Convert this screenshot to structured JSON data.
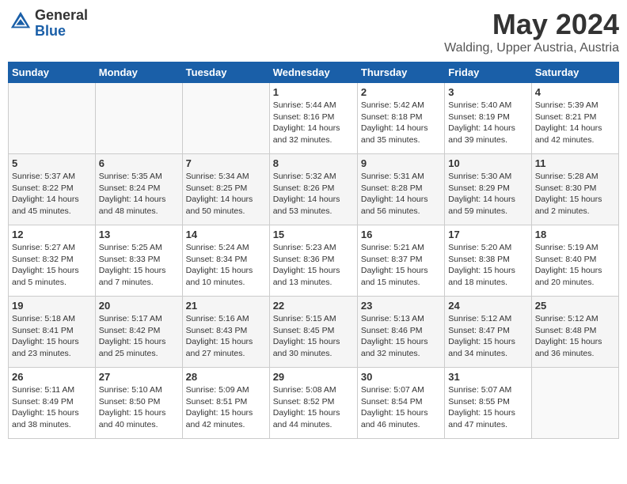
{
  "header": {
    "logo_line1": "General",
    "logo_line2": "Blue",
    "month_title": "May 2024",
    "location": "Walding, Upper Austria, Austria"
  },
  "days_of_week": [
    "Sunday",
    "Monday",
    "Tuesday",
    "Wednesday",
    "Thursday",
    "Friday",
    "Saturday"
  ],
  "weeks": [
    [
      {
        "day": "",
        "info": ""
      },
      {
        "day": "",
        "info": ""
      },
      {
        "day": "",
        "info": ""
      },
      {
        "day": "1",
        "info": "Sunrise: 5:44 AM\nSunset: 8:16 PM\nDaylight: 14 hours\nand 32 minutes."
      },
      {
        "day": "2",
        "info": "Sunrise: 5:42 AM\nSunset: 8:18 PM\nDaylight: 14 hours\nand 35 minutes."
      },
      {
        "day": "3",
        "info": "Sunrise: 5:40 AM\nSunset: 8:19 PM\nDaylight: 14 hours\nand 39 minutes."
      },
      {
        "day": "4",
        "info": "Sunrise: 5:39 AM\nSunset: 8:21 PM\nDaylight: 14 hours\nand 42 minutes."
      }
    ],
    [
      {
        "day": "5",
        "info": "Sunrise: 5:37 AM\nSunset: 8:22 PM\nDaylight: 14 hours\nand 45 minutes."
      },
      {
        "day": "6",
        "info": "Sunrise: 5:35 AM\nSunset: 8:24 PM\nDaylight: 14 hours\nand 48 minutes."
      },
      {
        "day": "7",
        "info": "Sunrise: 5:34 AM\nSunset: 8:25 PM\nDaylight: 14 hours\nand 50 minutes."
      },
      {
        "day": "8",
        "info": "Sunrise: 5:32 AM\nSunset: 8:26 PM\nDaylight: 14 hours\nand 53 minutes."
      },
      {
        "day": "9",
        "info": "Sunrise: 5:31 AM\nSunset: 8:28 PM\nDaylight: 14 hours\nand 56 minutes."
      },
      {
        "day": "10",
        "info": "Sunrise: 5:30 AM\nSunset: 8:29 PM\nDaylight: 14 hours\nand 59 minutes."
      },
      {
        "day": "11",
        "info": "Sunrise: 5:28 AM\nSunset: 8:30 PM\nDaylight: 15 hours\nand 2 minutes."
      }
    ],
    [
      {
        "day": "12",
        "info": "Sunrise: 5:27 AM\nSunset: 8:32 PM\nDaylight: 15 hours\nand 5 minutes."
      },
      {
        "day": "13",
        "info": "Sunrise: 5:25 AM\nSunset: 8:33 PM\nDaylight: 15 hours\nand 7 minutes."
      },
      {
        "day": "14",
        "info": "Sunrise: 5:24 AM\nSunset: 8:34 PM\nDaylight: 15 hours\nand 10 minutes."
      },
      {
        "day": "15",
        "info": "Sunrise: 5:23 AM\nSunset: 8:36 PM\nDaylight: 15 hours\nand 13 minutes."
      },
      {
        "day": "16",
        "info": "Sunrise: 5:21 AM\nSunset: 8:37 PM\nDaylight: 15 hours\nand 15 minutes."
      },
      {
        "day": "17",
        "info": "Sunrise: 5:20 AM\nSunset: 8:38 PM\nDaylight: 15 hours\nand 18 minutes."
      },
      {
        "day": "18",
        "info": "Sunrise: 5:19 AM\nSunset: 8:40 PM\nDaylight: 15 hours\nand 20 minutes."
      }
    ],
    [
      {
        "day": "19",
        "info": "Sunrise: 5:18 AM\nSunset: 8:41 PM\nDaylight: 15 hours\nand 23 minutes."
      },
      {
        "day": "20",
        "info": "Sunrise: 5:17 AM\nSunset: 8:42 PM\nDaylight: 15 hours\nand 25 minutes."
      },
      {
        "day": "21",
        "info": "Sunrise: 5:16 AM\nSunset: 8:43 PM\nDaylight: 15 hours\nand 27 minutes."
      },
      {
        "day": "22",
        "info": "Sunrise: 5:15 AM\nSunset: 8:45 PM\nDaylight: 15 hours\nand 30 minutes."
      },
      {
        "day": "23",
        "info": "Sunrise: 5:13 AM\nSunset: 8:46 PM\nDaylight: 15 hours\nand 32 minutes."
      },
      {
        "day": "24",
        "info": "Sunrise: 5:12 AM\nSunset: 8:47 PM\nDaylight: 15 hours\nand 34 minutes."
      },
      {
        "day": "25",
        "info": "Sunrise: 5:12 AM\nSunset: 8:48 PM\nDaylight: 15 hours\nand 36 minutes."
      }
    ],
    [
      {
        "day": "26",
        "info": "Sunrise: 5:11 AM\nSunset: 8:49 PM\nDaylight: 15 hours\nand 38 minutes."
      },
      {
        "day": "27",
        "info": "Sunrise: 5:10 AM\nSunset: 8:50 PM\nDaylight: 15 hours\nand 40 minutes."
      },
      {
        "day": "28",
        "info": "Sunrise: 5:09 AM\nSunset: 8:51 PM\nDaylight: 15 hours\nand 42 minutes."
      },
      {
        "day": "29",
        "info": "Sunrise: 5:08 AM\nSunset: 8:52 PM\nDaylight: 15 hours\nand 44 minutes."
      },
      {
        "day": "30",
        "info": "Sunrise: 5:07 AM\nSunset: 8:54 PM\nDaylight: 15 hours\nand 46 minutes."
      },
      {
        "day": "31",
        "info": "Sunrise: 5:07 AM\nSunset: 8:55 PM\nDaylight: 15 hours\nand 47 minutes."
      },
      {
        "day": "",
        "info": ""
      }
    ]
  ]
}
